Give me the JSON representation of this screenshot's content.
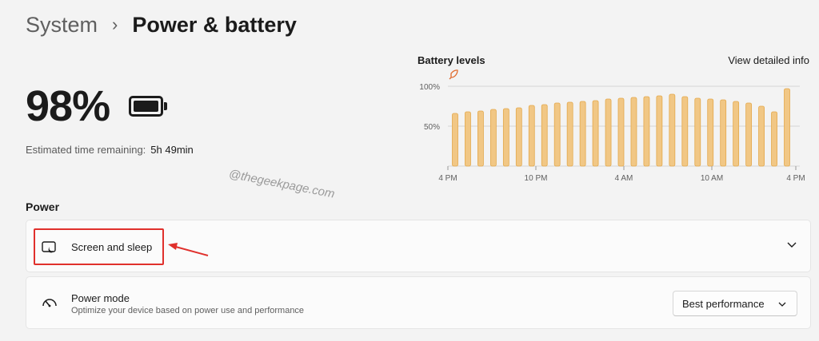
{
  "breadcrumb": {
    "parent": "System",
    "separator": "›",
    "current": "Power & battery"
  },
  "battery": {
    "percent_label": "98%",
    "estimate_label": "Estimated time remaining:",
    "estimate_value": "5h 49min"
  },
  "chart_data": {
    "type": "bar",
    "title": "Battery levels",
    "link": "View detailed info",
    "y_ticks": [
      "100%",
      "50%"
    ],
    "x_ticks": [
      "4 PM",
      "10 PM",
      "4 AM",
      "10 AM",
      "4 PM"
    ],
    "ylim": [
      0,
      100
    ],
    "grid": true,
    "bar_color": "#f1c785",
    "bar_edge_color": "#e3a84b",
    "values": [
      66,
      68,
      69,
      71,
      72,
      73,
      76,
      77,
      79,
      80,
      81,
      82,
      84,
      85,
      86,
      87,
      88,
      90,
      87,
      85,
      84,
      83,
      81,
      79,
      75,
      68,
      97
    ],
    "leaf_marker_label": "energy saver"
  },
  "watermark": "@thegeekpage.com",
  "power_section": {
    "label": "Power",
    "screen_sleep": {
      "label": "Screen and sleep",
      "icon": "screen-sleep-icon"
    },
    "power_mode": {
      "title": "Power mode",
      "description": "Optimize your device based on power use and performance",
      "selected": "Best performance",
      "icon": "gauge-icon"
    }
  },
  "colors": {
    "accent_highlight": "#e0302c",
    "background": "#f3f3f3",
    "card": "#fbfbfb"
  }
}
